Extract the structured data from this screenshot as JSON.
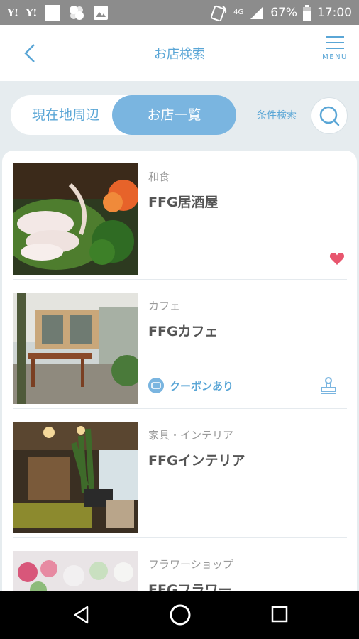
{
  "status_bar": {
    "time": "17:00",
    "battery": "67%",
    "network": "4G",
    "left_icons": [
      "yahoo-y-icon",
      "yahoo-y-icon",
      "notification-square-icon",
      "pinwheel-icon",
      "image-icon"
    ],
    "right_icons": [
      "data-sync-icon",
      "signal-icon",
      "battery-icon"
    ],
    "yahoo_label": "Y!"
  },
  "header": {
    "title": "お店検索",
    "menu_label": "MENU"
  },
  "segment": {
    "nearby": "現在地周辺",
    "list": "お店一覧",
    "selected": "お店一覧"
  },
  "search": {
    "conditions_label": "条件検索"
  },
  "shops": [
    {
      "category": "和食",
      "name": "FFG居酒屋",
      "favorite": true,
      "coupon": ""
    },
    {
      "category": "カフェ",
      "name": "FFGカフェ",
      "favorite": false,
      "coupon": "クーポンあり"
    },
    {
      "category": "家具・インテリア",
      "name": "FFGインテリア",
      "favorite": false,
      "coupon": ""
    },
    {
      "category": "フラワーショップ",
      "name": "FFGフラワー",
      "favorite": false,
      "coupon": ""
    }
  ],
  "colors": {
    "accent": "#5aa6d6",
    "accent_fill": "#7ab5e0",
    "background": "#e6ecef",
    "favorite": "#e8566e"
  }
}
